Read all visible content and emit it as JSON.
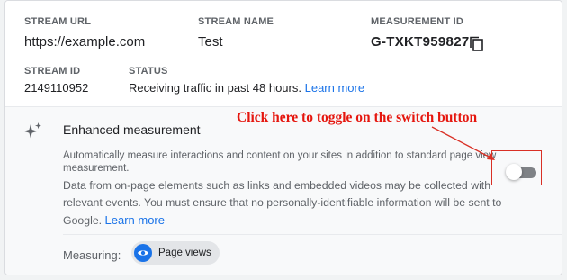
{
  "stream": {
    "url_label": "STREAM URL",
    "url_value": "https://example.com",
    "name_label": "STREAM NAME",
    "name_value": "Test",
    "measurement_label": "MEASUREMENT ID",
    "measurement_value": "G-TXKT959827",
    "id_label": "STREAM ID",
    "id_value": "2149110952",
    "status_label": "STATUS",
    "status_text": "Receiving traffic in past 48 hours.",
    "status_link": "Learn more"
  },
  "enhanced": {
    "title": "Enhanced measurement",
    "desc_line1": "Automatically measure interactions and content on your sites in addition to standard page view",
    "desc_line2": "measurement.",
    "desc_detail": "Data from on-page elements such as links and embedded videos may be collected with relevant events. You must ensure that no personally-identifiable information will be sent to Google.",
    "learn_more": "Learn more",
    "switch_on": false,
    "measuring_label": "Measuring:",
    "chip_label": "Page views"
  },
  "annotation": {
    "text": "Click here to toggle on the switch button",
    "color": "#e5160e"
  },
  "colors": {
    "accent": "#1a73e8",
    "label": "#5f6368",
    "switch_track": "#7f8286"
  }
}
